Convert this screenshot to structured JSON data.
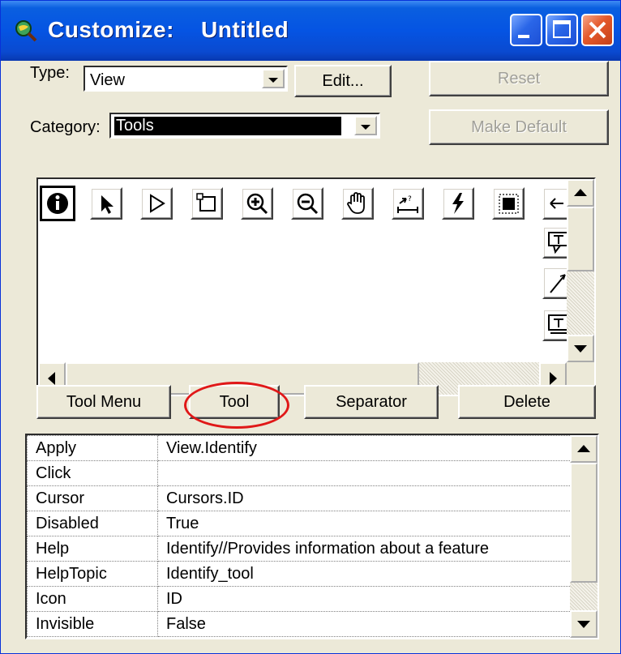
{
  "window": {
    "title": "Customize:    Untitled",
    "icon": "magnifier-globe-icon",
    "controls": [
      "minimize-icon",
      "maximize-icon",
      "close-icon"
    ]
  },
  "type": {
    "label": "Type:",
    "value": "View"
  },
  "category": {
    "label": "Category:",
    "value": "Tools"
  },
  "buttons": {
    "edit": "Edit...",
    "reset": "Reset",
    "make_default": "Make Default",
    "tool_menu": "Tool Menu",
    "tool": "Tool",
    "separator": "Separator",
    "delete": "Delete"
  },
  "tools": {
    "row": [
      "identify-icon",
      "pointer-icon",
      "vertex-pointer-icon",
      "select-box-icon",
      "zoom-in-icon",
      "zoom-out-icon",
      "pan-hand-icon",
      "measure-icon",
      "hotlink-icon",
      "select-feature-icon",
      "label-tool-icon"
    ],
    "column": [
      "text-label-icon",
      "draw-line-icon",
      "text-tool-icon"
    ]
  },
  "properties": [
    {
      "name": "Apply",
      "value": "View.Identify"
    },
    {
      "name": "Click",
      "value": ""
    },
    {
      "name": "Cursor",
      "value": "Cursors.ID"
    },
    {
      "name": "Disabled",
      "value": "True"
    },
    {
      "name": "Help",
      "value": "Identify//Provides information about a feature"
    },
    {
      "name": "HelpTopic",
      "value": "Identify_tool"
    },
    {
      "name": "Icon",
      "value": "ID"
    },
    {
      "name": "Invisible",
      "value": "False"
    }
  ],
  "colors": {
    "titlebar": "#0554e3",
    "face": "#ece9d8",
    "annotation": "#e01818"
  }
}
